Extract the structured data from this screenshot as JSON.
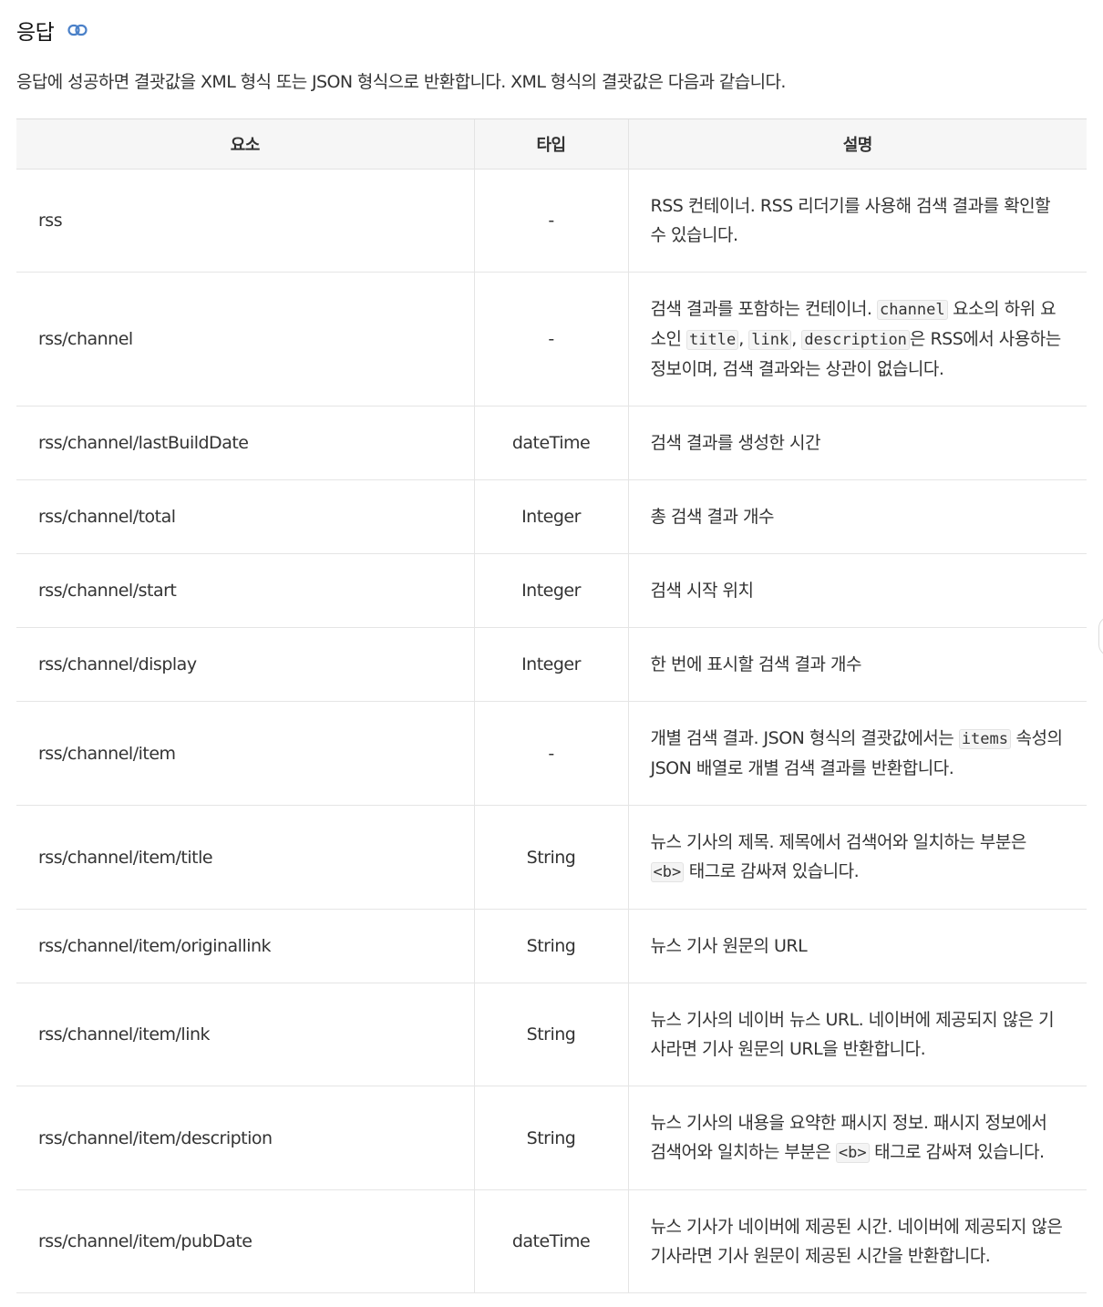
{
  "section": {
    "title": "응답",
    "intro": "응답에 성공하면 결괏값을 XML 형식 또는 JSON 형식으로 반환합니다. XML 형식의 결괏값은 다음과 같습니다."
  },
  "table": {
    "headers": {
      "element": "요소",
      "type": "타입",
      "description": "설명"
    },
    "rows": [
      {
        "element": "rss",
        "type": "-",
        "desc": [
          {
            "t": "RSS 컨테이너. RSS 리더기를 사용해 검색 결과를 확인할 수 있습니다."
          }
        ]
      },
      {
        "element": "rss/channel",
        "type": "-",
        "desc": [
          {
            "t": "검색 결과를 포함하는 컨테이너. "
          },
          {
            "code": "channel"
          },
          {
            "t": " 요소의 하위 요소인 "
          },
          {
            "code": "title"
          },
          {
            "t": ", "
          },
          {
            "code": "link"
          },
          {
            "t": ", "
          },
          {
            "code": "description"
          },
          {
            "t": "은 RSS에서 사용하는 정보이며, 검색 결과와는 상관이 없습니다."
          }
        ]
      },
      {
        "element": "rss/channel/lastBuildDate",
        "type": "dateTime",
        "desc": [
          {
            "t": "검색 결과를 생성한 시간"
          }
        ]
      },
      {
        "element": "rss/channel/total",
        "type": "Integer",
        "desc": [
          {
            "t": "총 검색 결과 개수"
          }
        ]
      },
      {
        "element": "rss/channel/start",
        "type": "Integer",
        "desc": [
          {
            "t": "검색 시작 위치"
          }
        ]
      },
      {
        "element": "rss/channel/display",
        "type": "Integer",
        "desc": [
          {
            "t": "한 번에 표시할 검색 결과 개수"
          }
        ]
      },
      {
        "element": "rss/channel/item",
        "type": "-",
        "desc": [
          {
            "t": "개별 검색 결과. JSON 형식의 결괏값에서는 "
          },
          {
            "code": "items"
          },
          {
            "t": " 속성의 JSON 배열로 개별 검색 결과를 반환합니다."
          }
        ]
      },
      {
        "element": "rss/channel/item/title",
        "type": "String",
        "desc": [
          {
            "t": "뉴스 기사의 제목. 제목에서 검색어와 일치하는 부분은 "
          },
          {
            "code": "<b>"
          },
          {
            "t": " 태그로 감싸져 있습니다."
          }
        ]
      },
      {
        "element": "rss/channel/item/originallink",
        "type": "String",
        "desc": [
          {
            "t": "뉴스 기사 원문의 URL"
          }
        ]
      },
      {
        "element": "rss/channel/item/link",
        "type": "String",
        "desc": [
          {
            "t": "뉴스 기사의 네이버 뉴스 URL. 네이버에 제공되지 않은 기사라면 기사 원문의 URL을 반환합니다."
          }
        ]
      },
      {
        "element": "rss/channel/item/description",
        "type": "String",
        "desc": [
          {
            "t": "뉴스 기사의 내용을 요약한 패시지 정보. 패시지 정보에서 검색어와 일치하는 부분은 "
          },
          {
            "code": "<b>"
          },
          {
            "t": " 태그로 감싸져 있습니다."
          }
        ]
      },
      {
        "element": "rss/channel/item/pubDate",
        "type": "dateTime",
        "desc": [
          {
            "t": "뉴스 기사가 네이버에 제공된 시간. 네이버에 제공되지 않은 기사라면 기사 원문이 제공된 시간을 반환합니다."
          }
        ]
      }
    ]
  },
  "icons": {
    "anchor": "link-icon"
  },
  "colors": {
    "link_icon": "#4a80c8",
    "header_bg": "#f6f6f6",
    "border": "#e5e5e5",
    "code_bg": "#f4f4f4"
  }
}
